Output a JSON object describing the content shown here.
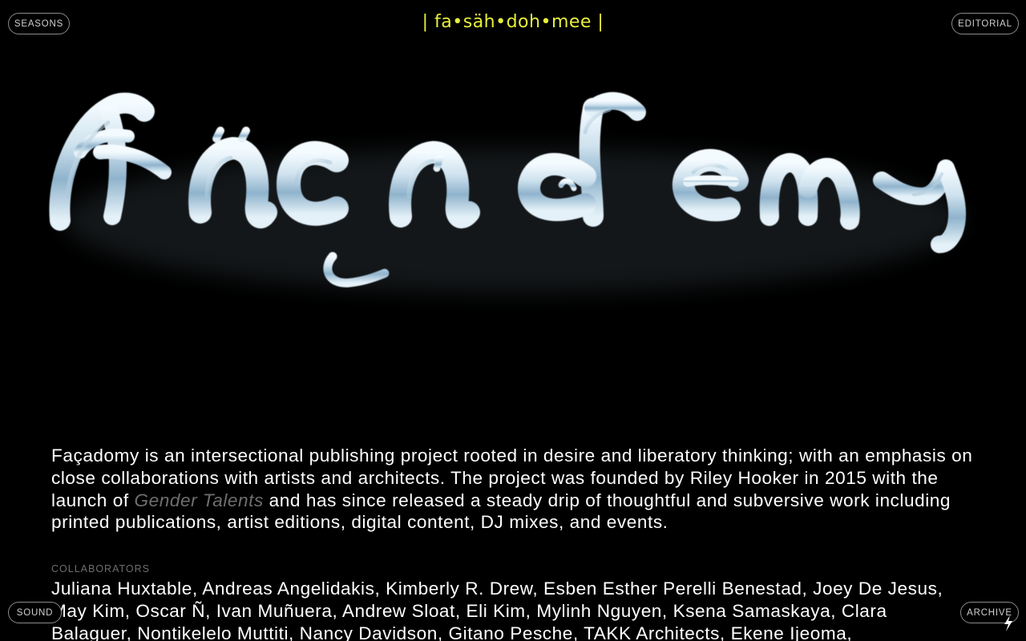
{
  "nav": {
    "seasons": "SEASONS",
    "editorial": "EDITORIAL",
    "sound": "SOUND",
    "archive": "ARCHIVE"
  },
  "header": {
    "pronunciation": "| fa•säh•doh•mee |"
  },
  "logo": {
    "text": "Façademy"
  },
  "about": {
    "before_link": "Façadomy is an intersectional publishing project rooted in desire and liberatory thinking; with an emphasis on close collaborations with artists and architects. The project was founded by Riley Hooker in 2015 with the launch of ",
    "link_text": "Gender Talents",
    "after_link": " and has since released a steady drip of thoughtful and subversive work including printed publications, artist editions, digital content, DJ mixes, and events."
  },
  "collaborators": {
    "label": "COLLABORATORS",
    "list": "Juliana Huxtable, Andreas Angelidakis, Kimberly R. Drew, Esben Esther Perelli Benestad, Joey De Jesus, May Kim, Oscar Ñ, Ivan Muñuera, Andrew Sloat, Eli Kim, Mylinh Nguyen, Ksena Samaskaya, Clara Balaguer, Nontikelelo Muttiti, Nancy Davidson, Gitano Pesche, TAKK Architects, Ekene Ijeoma,"
  },
  "icons": {
    "lightning": "lightning-icon"
  },
  "colors": {
    "background": "#000000",
    "accent_yellow": "#e7ef3a",
    "muted_gray": "#6e6e6e",
    "chrome_light": "#d8e8f2",
    "chrome_blue": "#8fb3cc"
  }
}
